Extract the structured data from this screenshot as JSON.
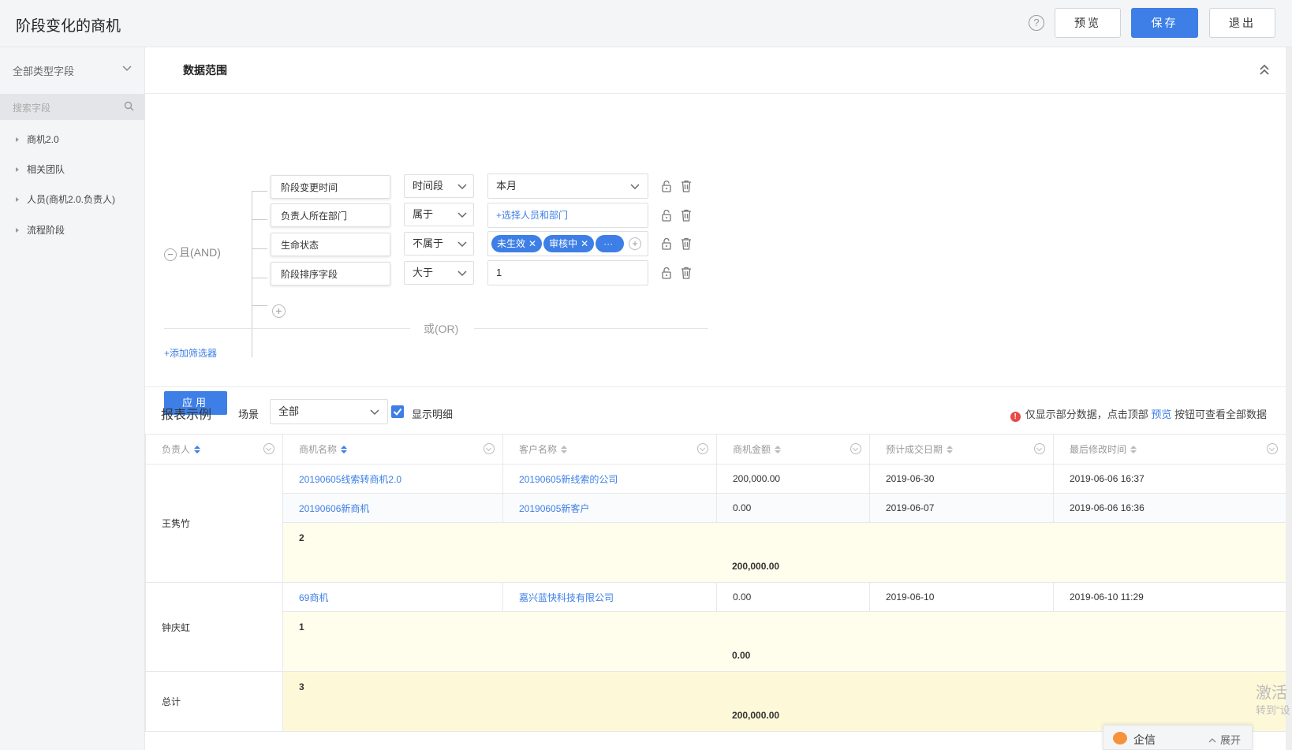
{
  "header": {
    "title": "阶段变化的商机",
    "help_icon": "?",
    "preview_label": "预览",
    "save_label": "保存",
    "exit_label": "退出"
  },
  "sidebar": {
    "type_select": "全部类型字段",
    "search_placeholder": "搜索字段",
    "items": [
      {
        "label": "商机2.0"
      },
      {
        "label": "相关团队"
      },
      {
        "label": "人员(商机2.0.负责人)"
      },
      {
        "label": "流程阶段"
      }
    ]
  },
  "data_range": {
    "title": "数据范围",
    "and_label": "且(AND)",
    "or_label": "或(OR)",
    "add_filter": "+添加筛选器",
    "apply_label": "应用",
    "conditions": [
      {
        "field": "阶段变更时间",
        "op": "时间段",
        "value": "本月"
      },
      {
        "field": "负责人所在部门",
        "op": "属于",
        "value": "+选择人员和部门"
      },
      {
        "field": "生命状态",
        "op": "不属于",
        "tags": [
          "未生效",
          "审核中",
          "···"
        ]
      },
      {
        "field": "阶段排序字段",
        "op": "大于",
        "value": "1"
      }
    ]
  },
  "report": {
    "title": "报表示例",
    "scene_label": "场景",
    "scene_value": "全部",
    "show_detail": "显示明细",
    "note_prefix": "仅显示部分数据，点击顶部",
    "note_link": "预览",
    "note_suffix": "按钮可查看全部数据",
    "columns": [
      "负责人",
      "商机名称",
      "客户名称",
      "商机金额",
      "预计成交日期",
      "最后修改时间"
    ],
    "groups": [
      {
        "owner": "王隽竹",
        "rows": [
          [
            "20190605线索转商机2.0",
            "20190605新线索的公司",
            "200,000.00",
            "2019-06-30",
            "2019-06-06 16:37"
          ],
          [
            "20190606新商机",
            "20190605新客户",
            "0.00",
            "2019-06-07",
            "2019-06-06 16:36"
          ]
        ],
        "count": "2",
        "sum": "200,000.00"
      },
      {
        "owner": "钟庆虹",
        "rows": [
          [
            "69商机",
            "嘉兴蓝快科技有限公司",
            "0.00",
            "2019-06-10",
            "2019-06-10 11:29"
          ]
        ],
        "count": "1",
        "sum": "0.00"
      }
    ],
    "total_label": "总计",
    "total_count": "3",
    "total_sum": "200,000.00"
  },
  "watermark": {
    "line1": "激活",
    "line2": "转到\"设"
  },
  "chat": {
    "name": "企信",
    "expand": "展开"
  },
  "colors": {
    "accent": "#3d7fe6",
    "subtotal_bg": "#fffdeb",
    "warn": "#e84a4a"
  }
}
